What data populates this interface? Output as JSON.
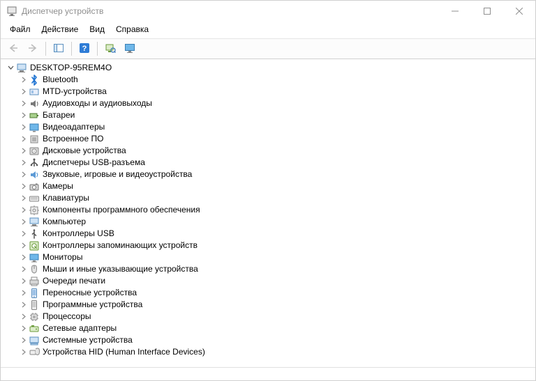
{
  "titlebar": {
    "title": "Диспетчер устройств"
  },
  "menu": {
    "file": "Файл",
    "action": "Действие",
    "view": "Вид",
    "help": "Справка"
  },
  "tree": {
    "root": {
      "label": "DESKTOP-95REM4O",
      "expanded": true
    },
    "items": [
      {
        "icon": "bluetooth",
        "label": "Bluetooth"
      },
      {
        "icon": "mtd",
        "label": "MTD-устройства"
      },
      {
        "icon": "audio",
        "label": "Аудиовходы и аудиовыходы"
      },
      {
        "icon": "battery",
        "label": "Батареи"
      },
      {
        "icon": "video",
        "label": "Видеоадаптеры"
      },
      {
        "icon": "firmware",
        "label": "Встроенное ПО"
      },
      {
        "icon": "disk",
        "label": "Дисковые устройства"
      },
      {
        "icon": "usb-hub",
        "label": "Диспетчеры USB-разъема"
      },
      {
        "icon": "sound",
        "label": "Звуковые, игровые и видеоустройства"
      },
      {
        "icon": "camera",
        "label": "Камеры"
      },
      {
        "icon": "keyboard",
        "label": "Клавиатуры"
      },
      {
        "icon": "component",
        "label": "Компоненты программного обеспечения"
      },
      {
        "icon": "computer",
        "label": "Компьютер"
      },
      {
        "icon": "usb",
        "label": "Контроллеры USB"
      },
      {
        "icon": "storage",
        "label": "Контроллеры запоминающих устройств"
      },
      {
        "icon": "monitor",
        "label": "Мониторы"
      },
      {
        "icon": "mouse",
        "label": "Мыши и иные указывающие устройства"
      },
      {
        "icon": "printq",
        "label": "Очереди печати"
      },
      {
        "icon": "portable",
        "label": "Переносные устройства"
      },
      {
        "icon": "software",
        "label": "Программные устройства"
      },
      {
        "icon": "cpu",
        "label": "Процессоры"
      },
      {
        "icon": "network",
        "label": "Сетевые адаптеры"
      },
      {
        "icon": "system",
        "label": "Системные устройства"
      },
      {
        "icon": "hid",
        "label": "Устройства HID (Human Interface Devices)"
      }
    ]
  }
}
